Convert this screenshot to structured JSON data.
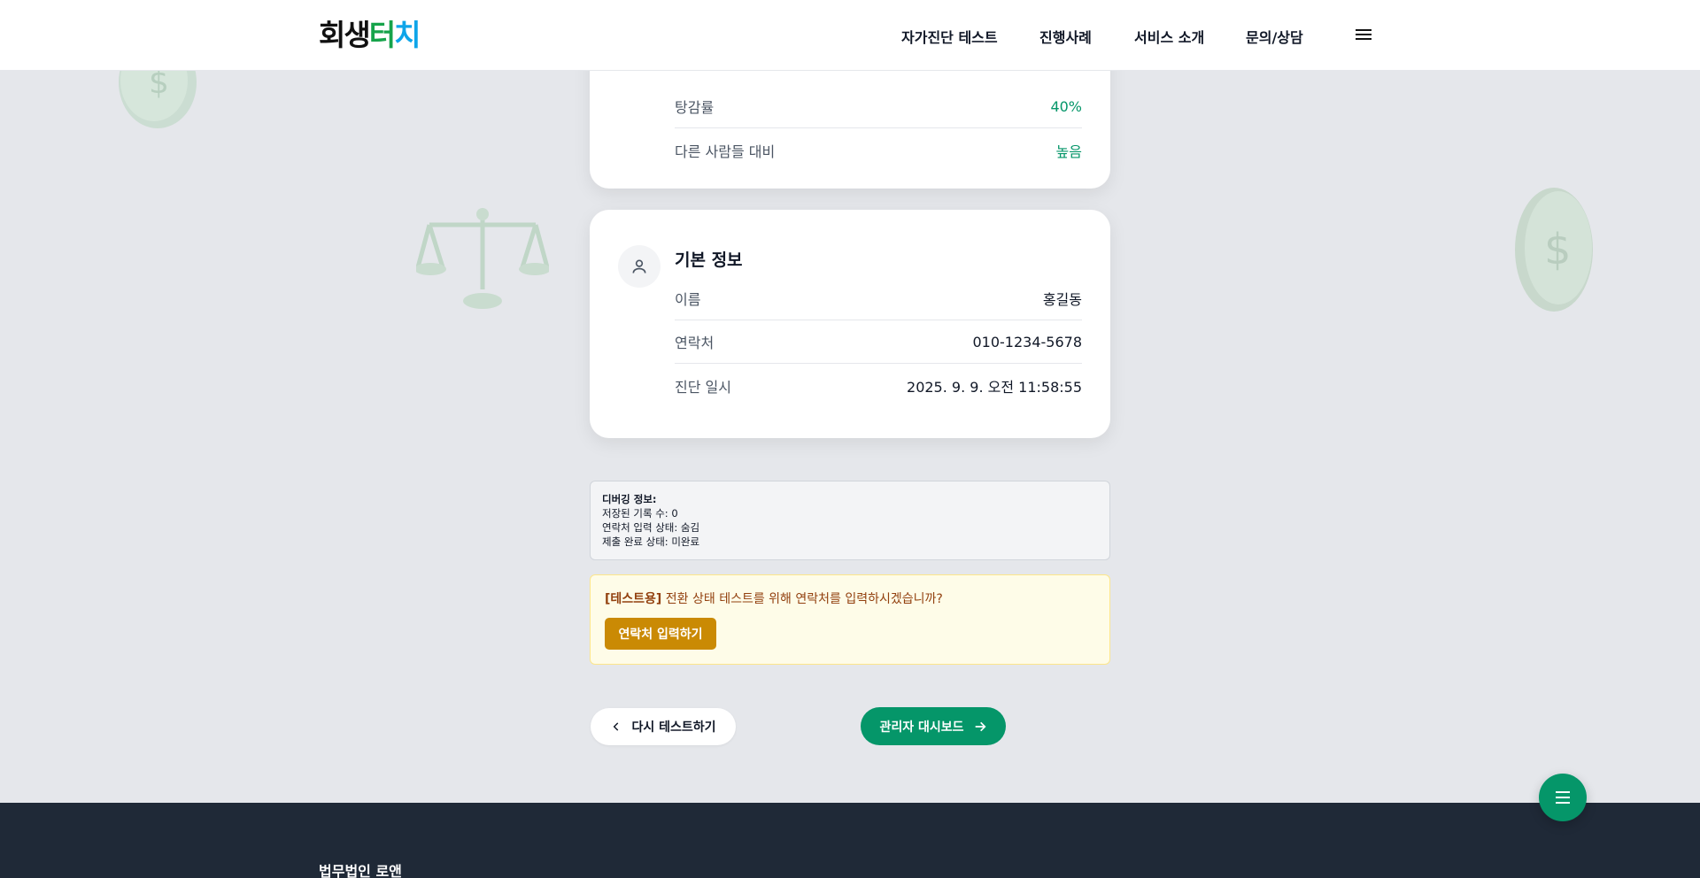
{
  "header": {
    "logo_parts": [
      "회생",
      "터",
      "치"
    ],
    "nav": [
      "자가진단 테스트",
      "진행사례",
      "서비스 소개",
      "문의/상담"
    ]
  },
  "summary_card": {
    "rows": [
      {
        "label": "탕감률",
        "value": "40%"
      },
      {
        "label": "다른 사람들 대비",
        "value": "높음"
      }
    ]
  },
  "basic_info": {
    "title": "기본 정보",
    "rows": [
      {
        "label": "이름",
        "value": "홍길동"
      },
      {
        "label": "연락처",
        "value": "010-1234-5678"
      },
      {
        "label": "진단 일시",
        "value": "2025. 9. 9. 오전 11:58:55"
      }
    ]
  },
  "debug": {
    "title": "디버깅 정보:",
    "lines": [
      "저장된 기록 수: 0",
      "연락처 입력 상태: 숨김",
      "제출 완료 상태: 미완료"
    ]
  },
  "test_box": {
    "tag": "[테스트용]",
    "text": "전환 상태 테스트를 위해 연락처를 입력하시겠습니까?",
    "button": "연락처 입력하기"
  },
  "buttons": {
    "retry": "다시 테스트하기",
    "admin": "관리자 대시보드"
  },
  "footer": {
    "title": "법무법인 로앤"
  },
  "colors": {
    "accent": "#059669",
    "background": "#e5e7eb",
    "footer": "#1f2937",
    "warning": "#ca8a04"
  }
}
